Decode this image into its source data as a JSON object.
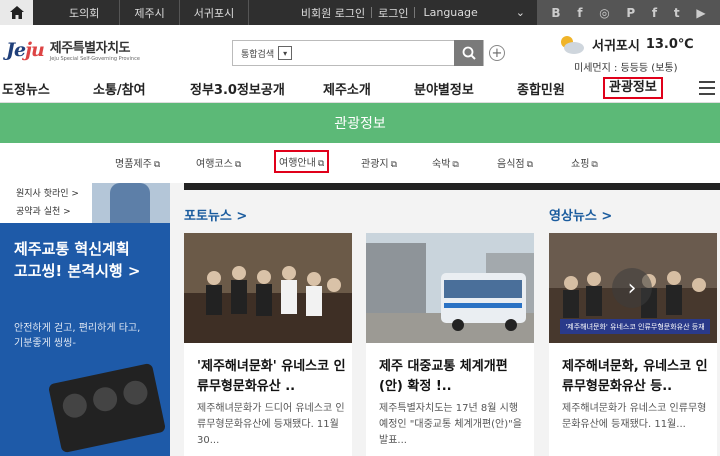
{
  "topbar": {
    "links": [
      "도의회",
      "제주시",
      "서귀포시"
    ],
    "member_login": "비회원 로그인",
    "login": "로그인",
    "language": "Language",
    "social": [
      "B",
      "f",
      "◎",
      "P",
      "f",
      "t",
      "▶"
    ]
  },
  "header": {
    "logo_word": "Jeju",
    "logo_ko": "제주특별자치도",
    "logo_en": "Jeju Special Self-Governing Province",
    "search_select": "통합검색",
    "weather_city": "서귀포시",
    "weather_temp": "13.0℃",
    "weather_dust": "미세먼지 : 등등등 (보통)"
  },
  "gnb": [
    "도정뉴스",
    "소통/참여",
    "정부3.0정보공개",
    "제주소개",
    "분야별정보",
    "종합민원",
    "관광정보"
  ],
  "section_banner": "관광정보",
  "subnav": [
    "명품제주",
    "여행코스",
    "여행안내",
    "관광지",
    "숙박",
    "음식점",
    "쇼핑"
  ],
  "left": {
    "links": [
      "원지사 핫라인 >",
      "공약과 실천 >"
    ],
    "banner_title1": "제주교통 혁신계획",
    "banner_title2": "고고씽! 본격시행 >",
    "banner_desc1": "안전하게 걷고, 편리하게 타고,",
    "banner_desc2": "기분좋게 씽씽-"
  },
  "photo_news": "포토뉴스 >",
  "video_news": "영상뉴스 >",
  "cards": [
    {
      "title": "'제주해녀문화' 유네스코 인류무형문화유산 ..",
      "desc": "제주해녀문화가 드디어 유네스코 인류무형문화유산에 등재됐다. 11월 30..."
    },
    {
      "title": "제주 대중교통 체계개편(안) 확정 !..",
      "desc": "제주특별자치도는 17년 8월 시행예정인 \"대중교통 체계개편(안)\"을 발표..."
    },
    {
      "title": "제주해녀문화, 유네스코 인류무형문화유산 등..",
      "desc": "제주해녀문화가 유네스코 인류무형문화유산에 등재됐다. 11월..."
    }
  ],
  "video_caption": "'제주해녀문화' 유네스코 인류무형문화유산 등재"
}
